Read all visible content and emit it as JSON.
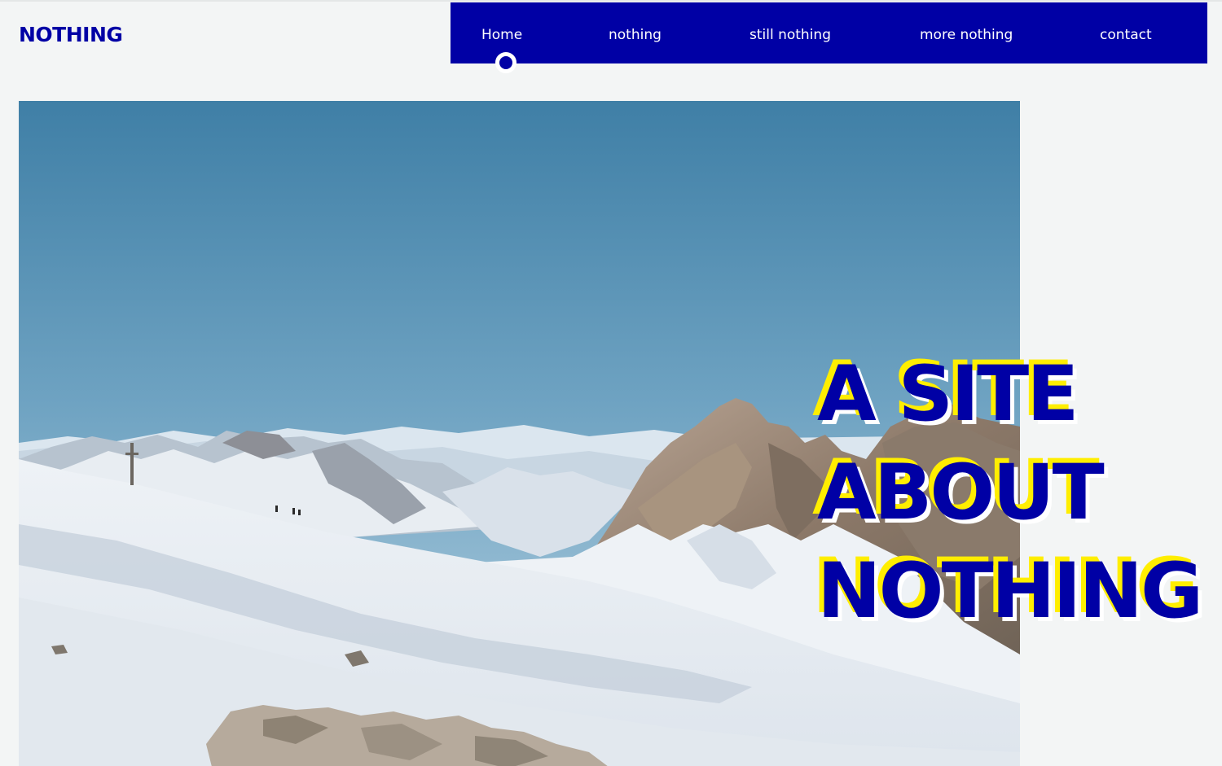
{
  "header": {
    "logo": "NOTHING"
  },
  "nav": {
    "items": [
      {
        "label": "Home",
        "active": true
      },
      {
        "label": "nothing",
        "active": false
      },
      {
        "label": "still nothing",
        "active": false
      },
      {
        "label": "more nothing",
        "active": false
      },
      {
        "label": "contact",
        "active": false
      }
    ]
  },
  "hero": {
    "image": "snowy-mountain-landscape",
    "headline": [
      "A SITE",
      "ABOUT",
      "NOTHING"
    ]
  },
  "colors": {
    "brand_blue": "#0000a5",
    "highlight_yellow": "#ffee00",
    "background": "#f3f5f5",
    "nav_text": "#ffffff"
  }
}
